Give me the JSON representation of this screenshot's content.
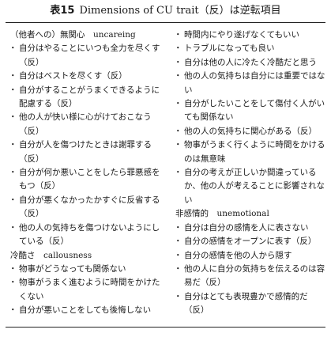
{
  "title": {
    "number": "表15",
    "text": "Dimensions of CU trait（反）は逆転項目"
  },
  "left": {
    "sections": [
      {
        "heading": "（他者への）無関心　uncareing",
        "items": [
          "自分はやることにいつも全力を尽くす（反）",
          "自分はベストを尽くす（反）",
          "自分がすることがうまくできるように配慮する（反）",
          "他の人が快い様に心がけておこなう（反）",
          "自分が人を傷つけたときは謝罪する（反）",
          "自分が何か悪いことをしたら罪悪感をもつ（反）",
          "自分が悪くなかったかすぐに反省する（反）",
          "他の人の気持ちを傷つけないようにしている（反）"
        ]
      },
      {
        "heading": "冷酷さ　callousness",
        "items": [
          "物事がどうなっても関係ない",
          "物事がうまく進むように時間をかけたくない",
          "自分が悪いことをしても後悔しない"
        ]
      }
    ]
  },
  "right": {
    "sections": [
      {
        "heading": "",
        "items": [
          "時間内にやり遂げなくてもいい",
          "トラブルになっても良い",
          "自分は他の人に冷たく冷酷だと思う",
          "他の人の気持ちは自分には重要ではない",
          "自分がしたいことをして傷付く人がいても関係ない",
          "他の人の気持ちに関心がある（反）",
          "物事がうまく行くように時間をかけるのは無意味",
          "自分の考えが正しいか間違っているか、他の人が考えることに影響されない"
        ]
      },
      {
        "heading": "非感情的　unemotional",
        "items": [
          "自分は自分の感情を人に表さない",
          "自分の感情をオープンに表す（反）",
          "自分の感情を他の人から隠す",
          "他の人に自分の気持ちを伝えるのは容易だ（反）",
          "自分はとても表現豊かで感情的だ（反）"
        ]
      }
    ]
  }
}
